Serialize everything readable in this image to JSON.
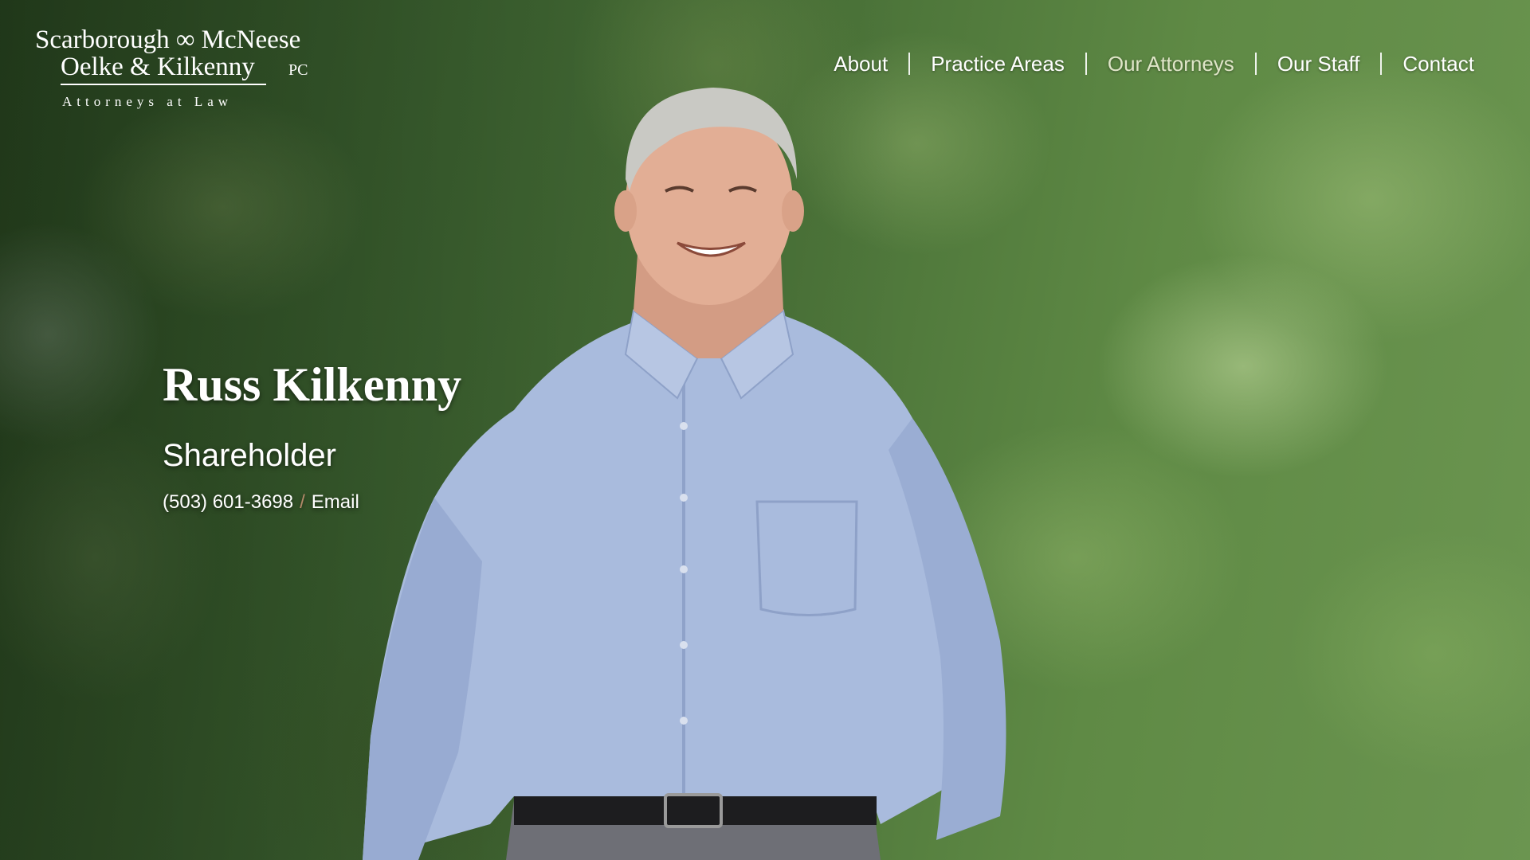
{
  "logo": {
    "line1": "Scarborough ∞ McNeese",
    "line2": "Oelke & Kilkenny",
    "suffix": "PC",
    "tagline": "Attorneys at Law"
  },
  "nav": {
    "items": [
      {
        "label": "About",
        "active": false
      },
      {
        "label": "Practice Areas",
        "active": false
      },
      {
        "label": "Our Attorneys",
        "active": true
      },
      {
        "label": "Our Staff",
        "active": false
      },
      {
        "label": "Contact",
        "active": false
      }
    ]
  },
  "attorney": {
    "name": "Russ Kilkenny",
    "title": "Shareholder",
    "phone": "(503) 601-3698",
    "separator": "/",
    "email_label": "Email"
  },
  "colors": {
    "foliage_dark": "#2b4a22",
    "foliage_light": "#6b9550",
    "shirt": "#a7b9dc",
    "active_nav": "#dfe5c8",
    "separator_accent": "#b48a6a"
  }
}
